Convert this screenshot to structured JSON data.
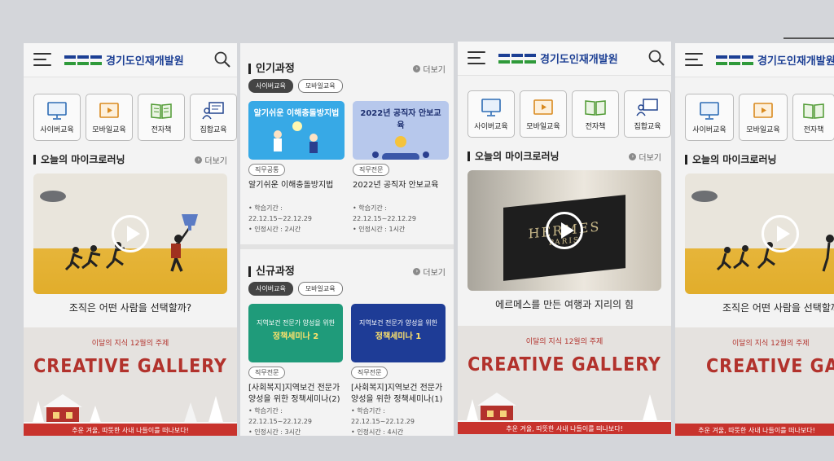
{
  "header": {
    "logo_text": "경기도인재개발원"
  },
  "quick_menu": [
    {
      "label": "사이버교육",
      "icon": "monitor-icon"
    },
    {
      "label": "모바일교육",
      "icon": "mobile-play-icon"
    },
    {
      "label": "전자책",
      "icon": "book-icon"
    },
    {
      "label": "집합교육",
      "icon": "classroom-icon"
    }
  ],
  "micro": {
    "title": "오늘의 마이크로러닝",
    "more": "더보기",
    "video1_caption": "조직은 어떤 사람을 선택할까?",
    "video2_caption": "에르메스를 만든 여행과 지리의 힘",
    "brand_sign_1": "HERMES",
    "brand_sign_2": "PARIS"
  },
  "gallery": {
    "subtitle": "이달의 지식 12월의 주제",
    "title": "CREATIVE GALLERY",
    "footer": "추운 겨울, 따뜻한 사내 나들이를 떠나보다!"
  },
  "popular": {
    "title": "인기과정",
    "more": "더보기",
    "chips": [
      "사이버교육",
      "모바일교육"
    ],
    "cards": [
      {
        "thumb_text": "알기쉬운 이해충돌방지법",
        "tag": "직무공통",
        "title": "알기쉬운 이해충돌방지법",
        "period": "• 학습기간 : 22.12.15~22.12.29",
        "hours": "• 인정시간 : 2시간"
      },
      {
        "thumb_text": "2022년 공직자 안보교육",
        "tag": "직무전문",
        "title": "2022년 공직자 안보교육",
        "period": "• 학습기간 : 22.12.15~22.12.29",
        "hours": "• 인정시간 : 1시간"
      }
    ]
  },
  "new_courses": {
    "title": "신규과정",
    "more": "더보기",
    "chips": [
      "사이버교육",
      "모바일교육"
    ],
    "cards": [
      {
        "thumb_line1": "지역보건 전문가 양성을 위한",
        "thumb_line2": "정책세미나 2",
        "tag": "직무전문",
        "title": "[사회복지]지역보건 전문가 양성을 위한 정책세미나(2)",
        "period": "• 학습기간 : 22.12.15~22.12.29",
        "hours": "• 인정시간 : 3시간"
      },
      {
        "thumb_line1": "지역보건 전문가 양성을 위한",
        "thumb_line2": "정책세미나 1",
        "tag": "직무전문",
        "title": "[사회복지]지역보건 전문가 양성을 위한 정책세미나(1)",
        "period": "• 학습기간 : 22.12.15~22.12.29",
        "hours": "• 인정시간 : 4시간"
      }
    ]
  },
  "colors": {
    "brand_blue": "#1c3f94",
    "brand_green": "#2f9a3a",
    "gallery_red": "#b2322c"
  }
}
